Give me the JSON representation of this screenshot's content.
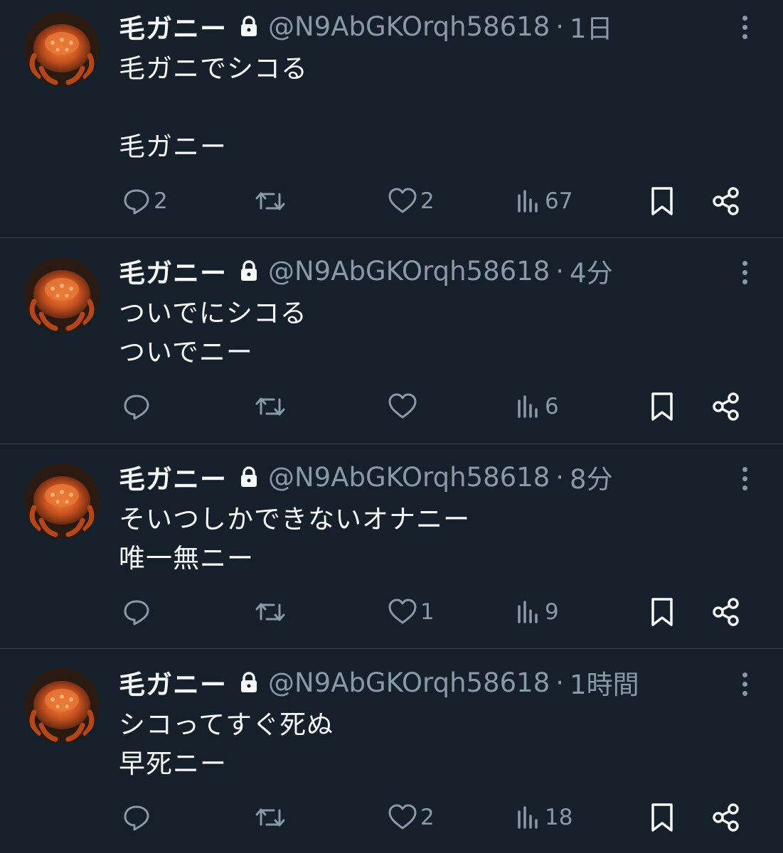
{
  "colors": {
    "background": "#15202b",
    "text": "#f7f9f9",
    "muted": "#8b98a5",
    "divider": "#38444d"
  },
  "tweets": [
    {
      "name": "毛ガニー",
      "handle": "@N9AbGKOrqh58618",
      "separator": "·",
      "time": "1日",
      "lines": [
        "毛ガニでシコる",
        "毛ガニー"
      ],
      "replies": "2",
      "retweets": "",
      "likes": "2",
      "views": "67"
    },
    {
      "name": "毛ガニー",
      "handle": "@N9AbGKOrqh58618",
      "separator": "·",
      "time": "4分",
      "lines": [
        "ついでにシコる",
        "ついでニー"
      ],
      "replies": "",
      "retweets": "",
      "likes": "",
      "views": "6"
    },
    {
      "name": "毛ガニー",
      "handle": "@N9AbGKOrqh58618",
      "separator": "·",
      "time": "8分",
      "lines": [
        "そいつしかできないオナニー",
        "唯一無ニー"
      ],
      "replies": "",
      "retweets": "",
      "likes": "1",
      "views": "9"
    },
    {
      "name": "毛ガニー",
      "handle": "@N9AbGKOrqh58618",
      "separator": "·",
      "time": "1時間",
      "lines": [
        "シコってすぐ死ぬ",
        "早死ニー"
      ],
      "replies": "",
      "retweets": "",
      "likes": "2",
      "views": "18"
    }
  ],
  "icons": {
    "avatar": "hairy-crab-photo",
    "lock": "lock-icon",
    "more": "more-vertical-icon",
    "reply": "reply-icon",
    "retweet": "retweet-icon",
    "like": "heart-icon",
    "views": "views-chart-icon",
    "bookmark": "bookmark-icon",
    "share": "share-icon"
  }
}
